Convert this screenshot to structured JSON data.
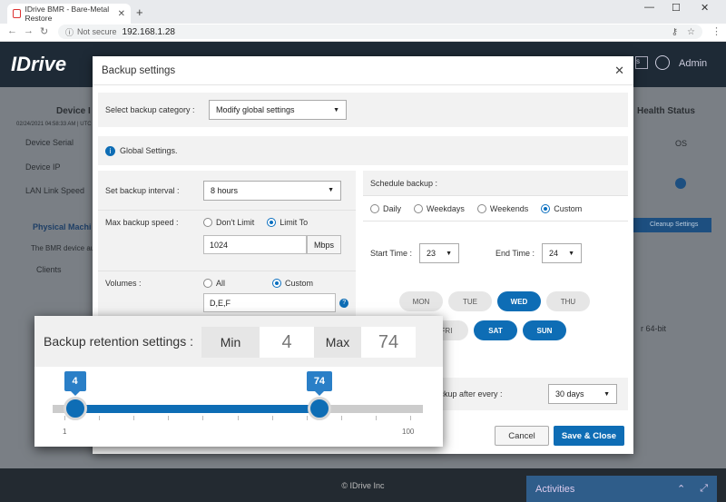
{
  "browser": {
    "tab_title": "IDrive BMR - Bare-Metal Restore",
    "new_tab": "+",
    "security": "Not secure",
    "url": "192.168.1.28",
    "win_min": "—",
    "win_max": "☐",
    "win_close": "✕"
  },
  "app": {
    "logo": "IDrive",
    "user": "Admin",
    "footer": "© IDrive Inc",
    "activities": "Activities",
    "bg_texts": {
      "device": "Device I",
      "date": "02/24/2021 04:58:33 AM | UTC",
      "device_serial": "Device Serial",
      "device_ip": "Device IP",
      "lan": "LAN Link Speed",
      "physical": "Physical Machi",
      "bmr_note": "The BMR device au",
      "clients": "Clients",
      "health": "Health Status",
      "os": "OS",
      "cleanup": "Cleanup Settings",
      "x64": "r 64-bit",
      "hdr_btn": "s"
    }
  },
  "modal": {
    "title": "Backup settings",
    "category_label": "Select backup category :",
    "category_value": "Modify global settings",
    "global_settings": "Global Settings.",
    "interval_label": "Set backup interval :",
    "interval_value": "8 hours",
    "speed_label": "Max backup speed :",
    "speed_opt1": "Don't Limit",
    "speed_opt2": "Limit To",
    "speed_value": "1024",
    "speed_unit": "Mbps",
    "volumes_label": "Volumes :",
    "vol_opt1": "All",
    "vol_opt2": "Custom",
    "vol_value": "D,E,F",
    "schedule_label": "Schedule backup :",
    "sched_opts": [
      "Daily",
      "Weekdays",
      "Weekends",
      "Custom"
    ],
    "start_label": "Start Time :",
    "start_value": "23",
    "end_label": "End Time :",
    "end_value": "24",
    "days_row1": [
      "MON",
      "TUE",
      "WED",
      "THU"
    ],
    "days_row2": [
      "FRI",
      "SAT",
      "SUN"
    ],
    "merge_label": "ge backup after every :",
    "merge_value": "30 days",
    "cancel": "Cancel",
    "save": "Save & Close"
  },
  "retention": {
    "label": "Backup retention settings :",
    "min_label": "Min",
    "min_value": "4",
    "max_label": "Max",
    "max_value": "74",
    "scale_min": "1",
    "scale_max": "100",
    "range_min": 1,
    "range_max": 100
  },
  "colors": {
    "accent": "#0e6db5",
    "nav": "#1e2a36"
  }
}
